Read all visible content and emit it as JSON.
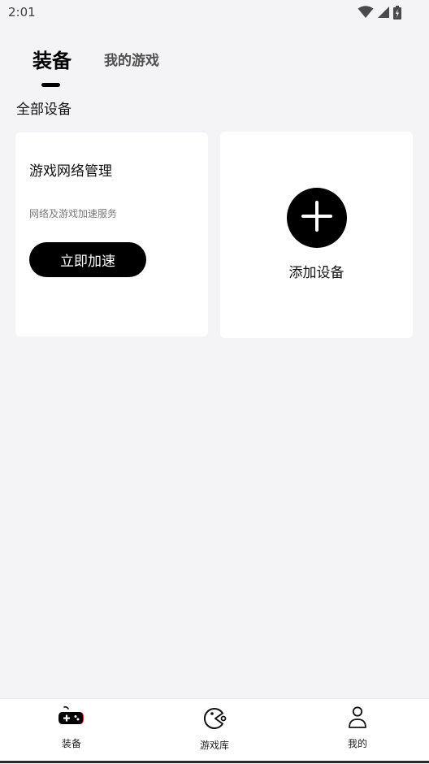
{
  "status_bar": {
    "time": "2:01",
    "icons": [
      "wifi-icon",
      "cell-signal-icon",
      "battery-charging-icon"
    ]
  },
  "tabs": [
    {
      "label": "装备",
      "active": true
    },
    {
      "label": "我的游戏",
      "active": false
    }
  ],
  "section": {
    "title": "全部设备"
  },
  "cards": {
    "network": {
      "title": "游戏网络管理",
      "description": "网络及游戏加速服务",
      "button_label": "立即加速"
    },
    "add_device": {
      "label": "添加设备",
      "icon": "plus-icon"
    }
  },
  "bottom_nav": {
    "items": [
      {
        "label": "装备",
        "icon": "gamepad-icon",
        "active": true
      },
      {
        "label": "游戏库",
        "icon": "pacman-icon",
        "active": false
      },
      {
        "label": "我的",
        "icon": "person-icon",
        "active": false
      }
    ]
  },
  "colors": {
    "background": "#f4f4f6",
    "card": "#ffffff",
    "accent": "#000000",
    "accent_red": "#e0283a"
  }
}
